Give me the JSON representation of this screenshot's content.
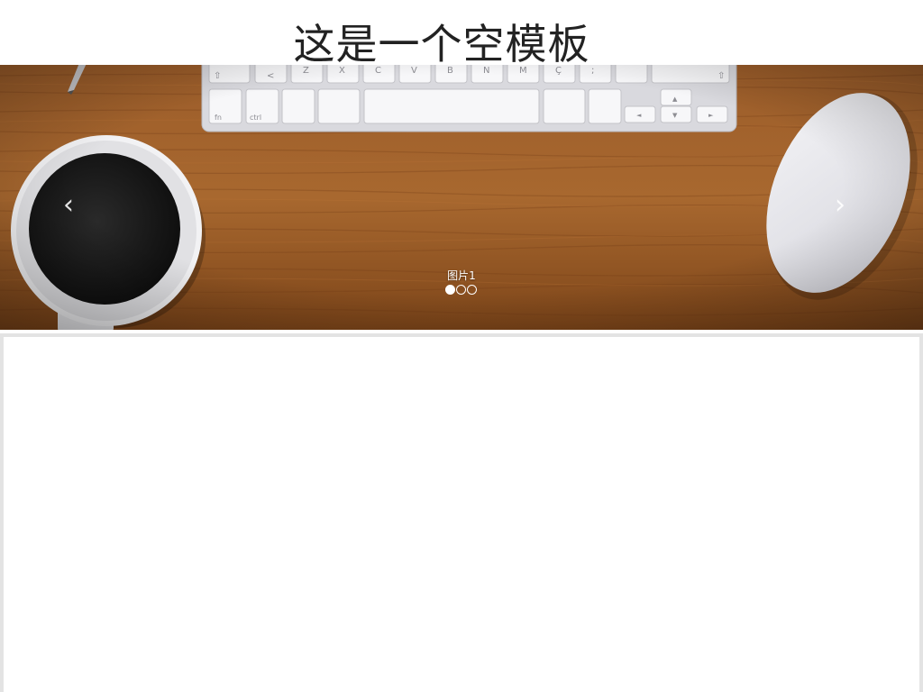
{
  "header": {
    "title": "这是一个空模板"
  },
  "carousel": {
    "prev_icon": "‹",
    "next_icon": "›",
    "caption": "图片1",
    "slide_count": 3,
    "active_index": 0,
    "keyboard_keys": {
      "row1": [
        "⇧",
        "<",
        "Z",
        "X",
        "C",
        "V",
        "B",
        "N",
        "M",
        "Ç",
        ";",
        "⇧"
      ],
      "row2": [
        "fn",
        "ctrl",
        "▲",
        "◄",
        "▼",
        "►"
      ]
    }
  },
  "colors": {
    "wood": "#9a5a27",
    "accent": "#ffffff",
    "panel_border": "#e3e3e3"
  }
}
